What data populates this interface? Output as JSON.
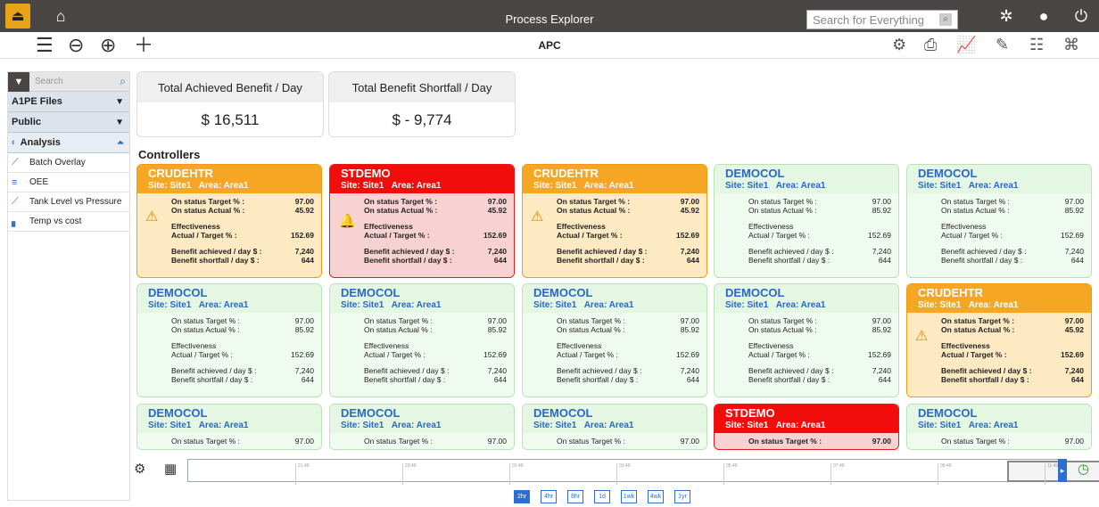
{
  "app": {
    "title": "Process Explorer",
    "search_placeholder": "Search for Everything",
    "sub_title": "APC"
  },
  "sidebar": {
    "search_placeholder": "Search",
    "drop1": "A1PE Files",
    "drop2": "Public",
    "section": "Analysis",
    "items": [
      "Batch Overlay",
      "OEE",
      "Tank Level vs Pressure",
      "Temp vs cost"
    ]
  },
  "kpis": [
    {
      "label": "Total Achieved Benefit / Day",
      "value": "$ 16,511"
    },
    {
      "label": "Total Benefit Shortfall / Day",
      "value": "$ - 9,774"
    }
  ],
  "controllers_label": "Controllers",
  "labels": {
    "on_target": "On status Target % :",
    "on_actual": "On status Actual % :",
    "effectiveness": "Effectiveness",
    "act_target": "Actual / Target % :",
    "achieved": "Benefit achieved / day $ :",
    "shortfall": "Benefit shortfall / day $ :",
    "site": "Site: Site1",
    "area": "Area: Area1"
  },
  "cards": [
    {
      "name": "CRUDEHTR",
      "status": "orange",
      "t": "97.00",
      "a": "45.92",
      "e": "152.69",
      "b": "7,240",
      "s": "644"
    },
    {
      "name": "STDEMO",
      "status": "red",
      "t": "97.00",
      "a": "45.92",
      "e": "152.69",
      "b": "7,240",
      "s": "644"
    },
    {
      "name": "CRUDEHTR",
      "status": "orange",
      "t": "97.00",
      "a": "45.92",
      "e": "152.69",
      "b": "7,240",
      "s": "644"
    },
    {
      "name": "DEMOCOL",
      "status": "green",
      "t": "97.00",
      "a": "85.92",
      "e": "152.69",
      "b": "7,240",
      "s": "644"
    },
    {
      "name": "DEMOCOL",
      "status": "green",
      "t": "97.00",
      "a": "85.92",
      "e": "152.69",
      "b": "7,240",
      "s": "644"
    },
    {
      "name": "DEMOCOL",
      "status": "green",
      "t": "97.00",
      "a": "85.92",
      "e": "152.69",
      "b": "7,240",
      "s": "644"
    },
    {
      "name": "DEMOCOL",
      "status": "green",
      "t": "97.00",
      "a": "85.92",
      "e": "152.69",
      "b": "7,240",
      "s": "644"
    },
    {
      "name": "DEMOCOL",
      "status": "green",
      "t": "97.00",
      "a": "85.92",
      "e": "152.69",
      "b": "7,240",
      "s": "644"
    },
    {
      "name": "DEMOCOL",
      "status": "green",
      "t": "97.00",
      "a": "85.92",
      "e": "152.69",
      "b": "7,240",
      "s": "644"
    },
    {
      "name": "CRUDEHTR",
      "status": "orange",
      "t": "97.00",
      "a": "45.92",
      "e": "152.69",
      "b": "7,240",
      "s": "644"
    },
    {
      "name": "DEMOCOL",
      "status": "green",
      "t": "97.00"
    },
    {
      "name": "DEMOCOL",
      "status": "green",
      "t": "97.00"
    },
    {
      "name": "DEMOCOL",
      "status": "green",
      "t": "97.00"
    },
    {
      "name": "STDEMO",
      "status": "red",
      "t": "97.00"
    },
    {
      "name": "DEMOCOL",
      "status": "green",
      "t": "97.00"
    }
  ],
  "timeline": {
    "ticks": [
      "21:49",
      "23:49",
      "01:49",
      "03:49",
      "05:49",
      "07:49",
      "09:49",
      "11:49"
    ],
    "ranges": [
      "2hr",
      "4hr",
      "8hr",
      "1d",
      "1wk",
      "4wk",
      "1yr"
    ],
    "active_range": "2hr"
  },
  "colors": {
    "green": "#2a67c6",
    "orange": "#f5a623",
    "red": "#f20d0d"
  }
}
